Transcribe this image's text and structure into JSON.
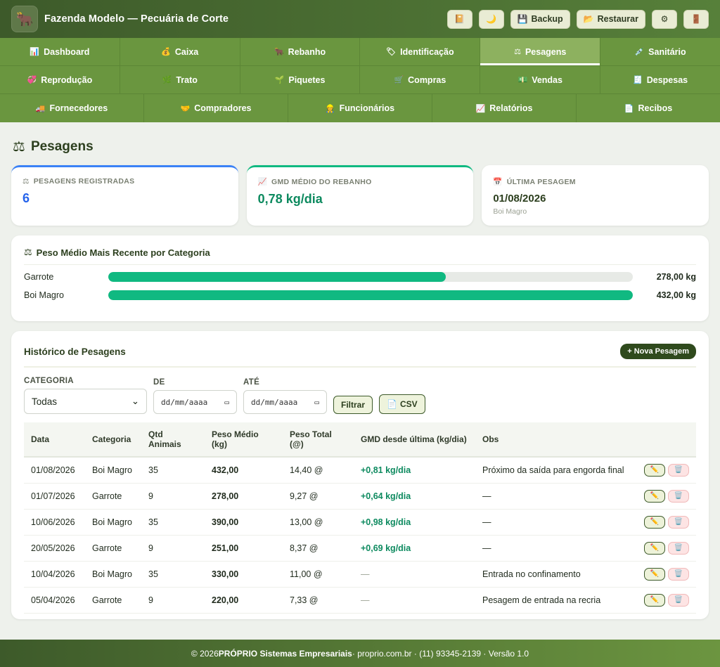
{
  "header": {
    "logo_icon": "cow-icon",
    "title": "Fazenda Modelo — Pecuária de Corte",
    "buttons": {
      "backup": "Backup",
      "restore": "Restaurar"
    }
  },
  "nav": {
    "rows": [
      [
        {
          "label": "Dashboard",
          "icon": "chart-icon"
        },
        {
          "label": "Caixa",
          "icon": "money-bag-icon"
        },
        {
          "label": "Rebanho",
          "icon": "cattle-icon"
        },
        {
          "label": "Identificação",
          "icon": "tag-icon"
        },
        {
          "label": "Pesagens",
          "icon": "scale-icon",
          "active": true
        },
        {
          "label": "Sanitário",
          "icon": "syringe-icon"
        }
      ],
      [
        {
          "label": "Reprodução",
          "icon": "heart-icon"
        },
        {
          "label": "Trato",
          "icon": "herb-icon"
        },
        {
          "label": "Piquetes",
          "icon": "sprout-icon"
        },
        {
          "label": "Compras",
          "icon": "cart-icon"
        },
        {
          "label": "Vendas",
          "icon": "cash-icon"
        },
        {
          "label": "Despesas",
          "icon": "receipt-icon"
        }
      ],
      [
        {
          "label": "Fornecedores",
          "icon": "truck-icon"
        },
        {
          "label": "Compradores",
          "icon": "handshake-icon"
        },
        {
          "label": "Funcionários",
          "icon": "worker-icon"
        },
        {
          "label": "Relatórios",
          "icon": "report-icon"
        },
        {
          "label": "Recibos",
          "icon": "document-icon"
        }
      ]
    ]
  },
  "page": {
    "title": "Pesagens"
  },
  "stats": {
    "registered": {
      "label": "PESAGENS REGISTRADAS",
      "value": "6"
    },
    "gmd": {
      "label": "GMD MÉDIO DO REBANHO",
      "value": "0,78 kg/dia"
    },
    "last": {
      "label": "ÚLTIMA PESAGEM",
      "value": "01/08/2026",
      "sub": "Boi Magro"
    }
  },
  "weights": {
    "title": "Peso Médio Mais Recente por Categoria",
    "items": [
      {
        "label": "Garrote",
        "value": "278,00 kg",
        "fraction": 0.6435
      },
      {
        "label": "Boi Magro",
        "value": "432,00 kg",
        "fraction": 1.0
      }
    ]
  },
  "history": {
    "title": "Histórico de Pesagens",
    "new_button": "+ Nova Pesagem",
    "filters": {
      "category_label": "CATEGORIA",
      "category_value": "Todas",
      "from_label": "DE",
      "to_label": "ATÉ",
      "date_placeholder": "dd/mm/aaaa",
      "filter_button": "Filtrar",
      "csv_button": "CSV"
    },
    "columns": [
      "Data",
      "Categoria",
      "Qtd Animais",
      "Peso Médio (kg)",
      "Peso Total (@)",
      "GMD desde última (kg/dia)",
      "Obs"
    ],
    "rows": [
      {
        "date": "01/08/2026",
        "category": "Boi Magro",
        "qty": "35",
        "avg": "432,00",
        "total": "14,40 @",
        "gmd": "+0,81 kg/dia",
        "obs": "Próximo da saída para engorda final"
      },
      {
        "date": "01/07/2026",
        "category": "Garrote",
        "qty": "9",
        "avg": "278,00",
        "total": "9,27 @",
        "gmd": "+0,64 kg/dia",
        "obs": "—"
      },
      {
        "date": "10/06/2026",
        "category": "Boi Magro",
        "qty": "35",
        "avg": "390,00",
        "total": "13,00 @",
        "gmd": "+0,98 kg/dia",
        "obs": "—"
      },
      {
        "date": "20/05/2026",
        "category": "Garrote",
        "qty": "9",
        "avg": "251,00",
        "total": "8,37 @",
        "gmd": "+0,69 kg/dia",
        "obs": "—"
      },
      {
        "date": "10/04/2026",
        "category": "Boi Magro",
        "qty": "35",
        "avg": "330,00",
        "total": "11,00 @",
        "gmd": "—",
        "obs": "Entrada no confinamento"
      },
      {
        "date": "05/04/2026",
        "category": "Garrote",
        "qty": "9",
        "avg": "220,00",
        "total": "7,33 @",
        "gmd": "—",
        "obs": "Pesagem de entrada na recria"
      }
    ]
  },
  "footer": {
    "prefix": "© 2026 ",
    "brand": "PRÓPRIO Sistemas Empresariais",
    "rest": " · proprio.com.br · (11) 93345-2139 · Versão 1.0"
  }
}
